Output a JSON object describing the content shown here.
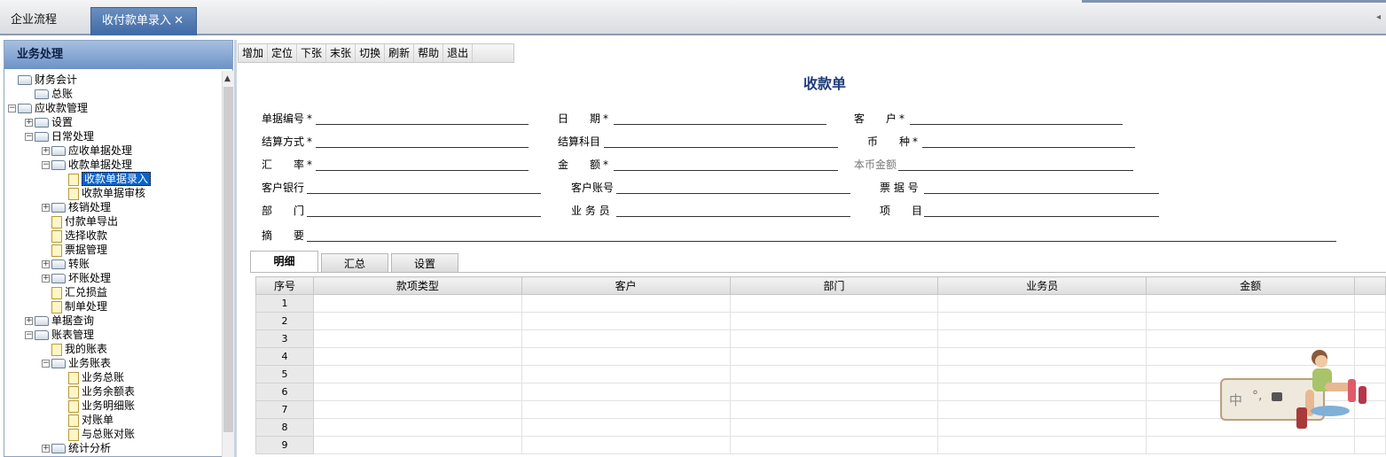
{
  "tabs": [
    {
      "label": "企业流程",
      "active": false
    },
    {
      "label": "收付款单录入",
      "active": true,
      "close": "✕"
    }
  ],
  "left_panel": {
    "title": "业务处理",
    "tree": [
      {
        "label": "财务会计",
        "level": 0,
        "kind": "folder",
        "expander": ""
      },
      {
        "label": "总账",
        "level": 1,
        "kind": "folder",
        "expander": ""
      },
      {
        "label": "应收款管理",
        "level": 0,
        "kind": "folder",
        "expander": "−"
      },
      {
        "label": "设置",
        "level": 1,
        "kind": "folder",
        "expander": "+"
      },
      {
        "label": "日常处理",
        "level": 1,
        "kind": "folder",
        "expander": "−"
      },
      {
        "label": "应收单据处理",
        "level": 2,
        "kind": "folder",
        "expander": "+"
      },
      {
        "label": "收款单据处理",
        "level": 2,
        "kind": "folder",
        "expander": "−"
      },
      {
        "label": "收款单据录入",
        "level": 3,
        "kind": "doc",
        "expander": "",
        "selected": true
      },
      {
        "label": "收款单据审核",
        "level": 3,
        "kind": "doc",
        "expander": ""
      },
      {
        "label": "核销处理",
        "level": 2,
        "kind": "folder",
        "expander": "+"
      },
      {
        "label": "付款单导出",
        "level": 2,
        "kind": "doc",
        "expander": ""
      },
      {
        "label": "选择收款",
        "level": 2,
        "kind": "doc",
        "expander": ""
      },
      {
        "label": "票据管理",
        "level": 2,
        "kind": "doc",
        "expander": ""
      },
      {
        "label": "转账",
        "level": 2,
        "kind": "folder",
        "expander": "+"
      },
      {
        "label": "坏账处理",
        "level": 2,
        "kind": "folder",
        "expander": "+"
      },
      {
        "label": "汇兑损益",
        "level": 2,
        "kind": "doc",
        "expander": ""
      },
      {
        "label": "制单处理",
        "level": 2,
        "kind": "doc",
        "expander": ""
      },
      {
        "label": "单据查询",
        "level": 1,
        "kind": "folder",
        "expander": "+"
      },
      {
        "label": "账表管理",
        "level": 1,
        "kind": "folder",
        "expander": "−"
      },
      {
        "label": "我的账表",
        "level": 2,
        "kind": "doc",
        "expander": ""
      },
      {
        "label": "业务账表",
        "level": 2,
        "kind": "folder",
        "expander": "−"
      },
      {
        "label": "业务总账",
        "level": 3,
        "kind": "doc",
        "expander": ""
      },
      {
        "label": "业务余额表",
        "level": 3,
        "kind": "doc",
        "expander": ""
      },
      {
        "label": "业务明细账",
        "level": 3,
        "kind": "doc",
        "expander": ""
      },
      {
        "label": "对账单",
        "level": 3,
        "kind": "doc",
        "expander": ""
      },
      {
        "label": "与总账对账",
        "level": 3,
        "kind": "doc",
        "expander": ""
      },
      {
        "label": "统计分析",
        "level": 2,
        "kind": "folder",
        "expander": "+"
      }
    ]
  },
  "toolbar": [
    "增加",
    "定位",
    "下张",
    "末张",
    "切换",
    "刷新",
    "帮助",
    "退出"
  ],
  "form": {
    "title": "收款单",
    "required_mark": "*",
    "fields": {
      "doc_no": "单据编号",
      "date": "日　　期",
      "customer": "客　　户",
      "settle_method": "结算方式",
      "settle_account": "结算科目",
      "currency": "币　　种",
      "rate": "汇　　率",
      "amount": "金　　额",
      "local_amount": "本币金额",
      "cust_bank": "客户银行",
      "cust_account": "客户账号",
      "bill_no": "票 据 号",
      "dept": "部　　门",
      "salesman": "业 务 员",
      "project": "项　　目",
      "summary": "摘　　要"
    }
  },
  "detail_tabs": [
    "明细",
    "汇总",
    "设置"
  ],
  "grid": {
    "columns": [
      "序号",
      "款项类型",
      "客户",
      "部门",
      "业务员",
      "金额"
    ],
    "rows": [
      "1",
      "2",
      "3",
      "4",
      "5",
      "6",
      "7",
      "8",
      "9"
    ]
  },
  "ime": {
    "mode": "中",
    "punct": "°,"
  }
}
